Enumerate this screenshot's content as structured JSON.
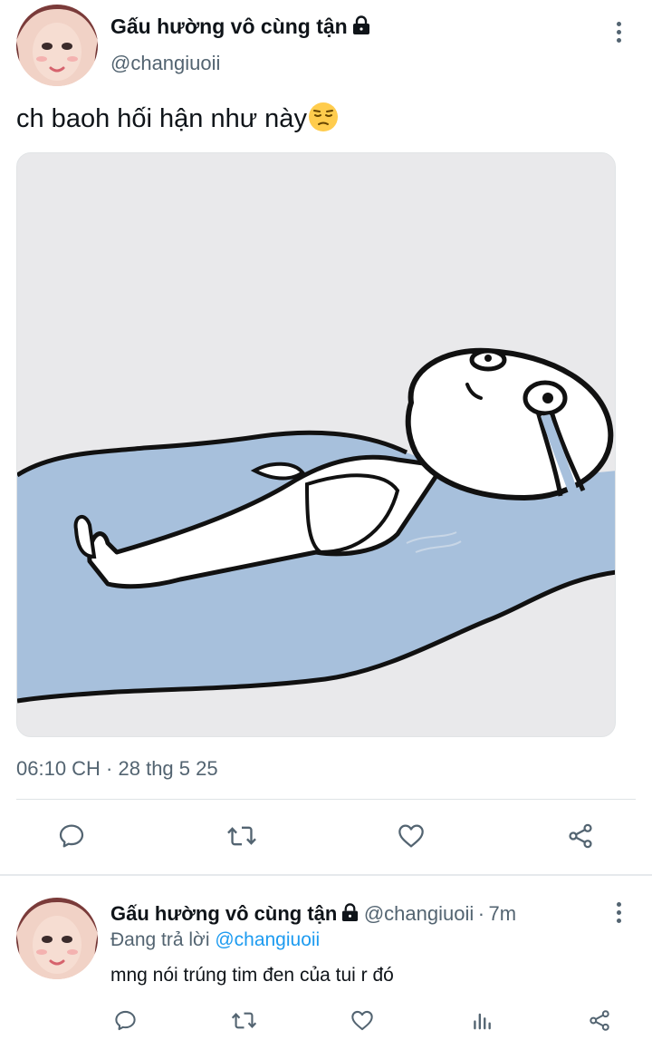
{
  "tweet": {
    "display_name": "Gấu hường vô cùng tận",
    "handle": "@changiuoii",
    "text": "ch baoh hối hận như này",
    "emoji_icon": "pensive-face-emoji",
    "timestamp": "06:10 CH · 28 thg 5 25",
    "actions": [
      "reply-icon",
      "retweet-icon",
      "like-icon",
      "share-icon"
    ]
  },
  "reply": {
    "display_name": "Gấu hường vô cùng tận",
    "handle": "@changiuoii",
    "separator": "·",
    "time": "7m",
    "replying_prefix": "Đang trả lời",
    "replying_to": "@changiuoii",
    "text": "mng nói trúng tim đen của tui r đó",
    "actions": [
      "reply-icon",
      "retweet-icon",
      "like-icon",
      "analytics-icon",
      "share-icon"
    ]
  },
  "colors": {
    "accent": "#1d9bf0",
    "secondary_text": "#536471",
    "primary_text": "#0f1419",
    "meme_water": "#a7c0dc"
  }
}
